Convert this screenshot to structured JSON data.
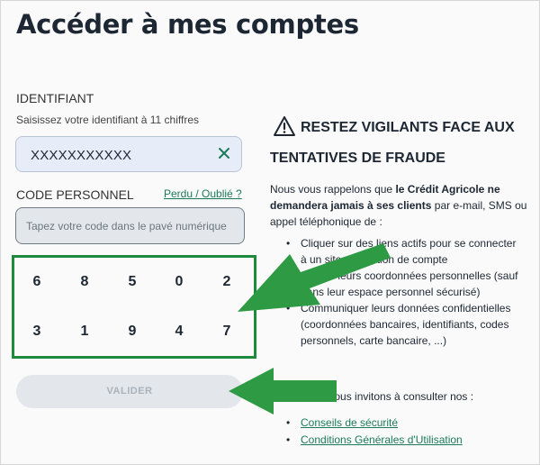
{
  "page": {
    "title": "Accéder à mes comptes"
  },
  "identifier": {
    "label": "IDENTIFIANT",
    "hint": "Saisissez votre identifiant à 11 chiffres",
    "value": "XXXXXXXXXXX",
    "clear_icon": "close-icon"
  },
  "code": {
    "label": "CODE PERSONNEL",
    "forgot_link": "Perdu / Oublié ?",
    "placeholder": "Tapez votre code dans le pavé numérique"
  },
  "keypad": {
    "keys": [
      "6",
      "8",
      "5",
      "0",
      "2",
      "3",
      "1",
      "9",
      "4",
      "7"
    ]
  },
  "validate_button": "VALIDER",
  "warning": {
    "icon": "warning-triangle-icon",
    "title_line1": "RESTEZ VIGILANTS FACE AUX",
    "title_line2": "TENTATIVES DE FRAUDE",
    "para_intro": "Nous vous rappelons que ",
    "para_bold": "le Crédit Agricole ne demandera jamais à ses clients",
    "para_rest": " par e-mail, SMS ou appel téléphonique de :",
    "items": [
      "Cliquer sur des liens actifs pour se connecter à un site de gestion de compte",
      "Fournir leurs coordonnées personnelles (sauf dans leur espace personnel sécurisé)",
      "Communiquer leurs données confidentielles (coordonnées bancaires, identifiants, codes personnels, carte bancaire, ...)"
    ],
    "invite": "Nous vous invitons à consulter nos :",
    "links": [
      "Conseils de sécurité",
      "Conditions Générales d'Utilisation"
    ]
  },
  "colors": {
    "accent_green": "#1e8a3b",
    "link_green": "#1a7a5a",
    "annotation_arrow": "#2e9a44"
  }
}
